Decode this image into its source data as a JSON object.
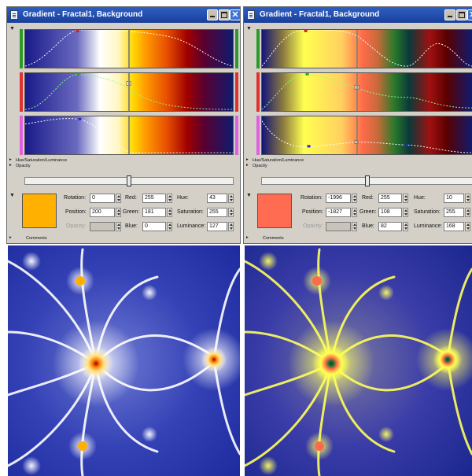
{
  "windows": [
    {
      "title": "Gradient - Fractal1, Background",
      "sections": {
        "hsl": "Hue/Saturation/Luminance",
        "opacity": "Opacity",
        "comments": "Comments"
      },
      "swatch_color": "#ffb000",
      "fields": {
        "rotation": {
          "label": "Rotation:",
          "value": "0"
        },
        "position": {
          "label": "Position:",
          "value": "200"
        },
        "opacity": {
          "label": "Opacity:",
          "value": ""
        },
        "red": {
          "label": "Red:",
          "value": "255"
        },
        "green": {
          "label": "Green:",
          "value": "181"
        },
        "blue": {
          "label": "Blue:",
          "value": "0"
        },
        "hue": {
          "label": "Hue:",
          "value": "43"
        },
        "saturation": {
          "label": "Saturation:",
          "value": "255"
        },
        "luminance": {
          "label": "Luminance:",
          "value": "127"
        }
      },
      "opacity_slider_fraction": 0.5
    },
    {
      "title": "Gradient - Fractal1, Background",
      "sections": {
        "hsl": "Hue/Saturation/Luminance",
        "opacity": "Opacity",
        "comments": "Comments"
      },
      "swatch_color": "#ff6c52",
      "fields": {
        "rotation": {
          "label": "Rotation:",
          "value": "-1996"
        },
        "position": {
          "label": "Position:",
          "value": "-1827"
        },
        "opacity": {
          "label": "Opacity:",
          "value": ""
        },
        "red": {
          "label": "Red:",
          "value": "255"
        },
        "green": {
          "label": "Green:",
          "value": "108"
        },
        "blue": {
          "label": "Blue:",
          "value": "82"
        },
        "hue": {
          "label": "Hue:",
          "value": "10"
        },
        "saturation": {
          "label": "Saturation:",
          "value": "255"
        },
        "luminance": {
          "label": "Luminance:",
          "value": "168"
        }
      },
      "opacity_slider_fraction": 0.5
    }
  ],
  "icons": [
    "window-icon",
    "minimize-icon",
    "maximize-icon",
    "close-icon",
    "expand-arrow-icon"
  ],
  "colors": {
    "left_gradient": [
      "#1a1a8a",
      "#ffffff",
      "#ffe26a",
      "#ffa000",
      "#e85000",
      "#a00000",
      "#5a0030",
      "#101a6e"
    ],
    "right_gradient": [
      "#14147a",
      "#ffff50",
      "#ffd060",
      "#ff6a4a",
      "#2a7a2a",
      "#0a3a3a",
      "#a01010",
      "#5a0000",
      "#101a6e"
    ],
    "fractal_bg": "#2a38b4",
    "titlebar": "#2450b8"
  }
}
